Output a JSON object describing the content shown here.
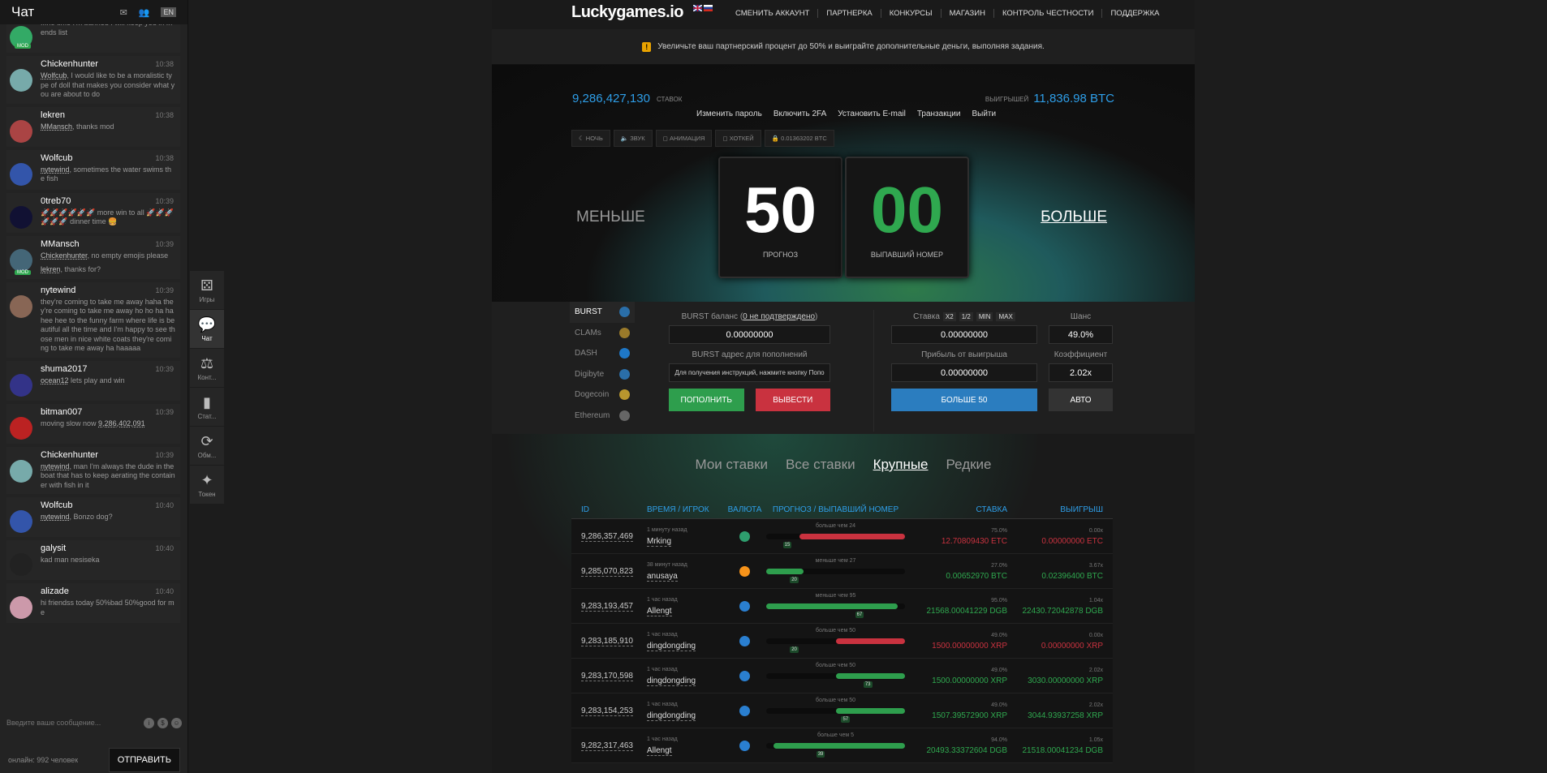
{
  "chat": {
    "title": "Чат",
    "lang": "EN",
    "messages": [
      {
        "name": "",
        "time": "",
        "text": "...no time I'm banned I will keep you in friends list",
        "mod": "MOD",
        "avatar_color": "#3a6"
      },
      {
        "name": "Chickenhunter",
        "time": "10:38",
        "ref": "Wolfcub",
        "text": ", I would like to be a moralistic type of doll that makes you consider what you are about to do",
        "avatar_color": "#7aa"
      },
      {
        "name": "lekren",
        "time": "10:38",
        "ref": "MMansch",
        "text": ", thanks mod",
        "avatar_color": "#a44"
      },
      {
        "name": "Wolfcub",
        "time": "10:38",
        "ref": "nytewind",
        "text": ", sometimes the water swims the fish",
        "avatar_color": "#35a"
      },
      {
        "name": "0treb70",
        "time": "10:39",
        "text": "🚀🚀🚀🚀🚀🚀 more win to all 🚀🚀🚀🚀🚀🚀 dinner time 🍔",
        "avatar_color": "#113"
      },
      {
        "name": "MMansch",
        "time": "10:39",
        "ref": "Chickenhunter",
        "text": ", no empty emojis please",
        "ref2": "lekren",
        "text2": ", thanks for?",
        "mod": "MOD",
        "avatar_color": "#467"
      },
      {
        "name": "nytewind",
        "time": "10:39",
        "text": "they're coming to take me away haha they're coming to take me away ho ho ha ha hee hee to the funny farm where life is beautiful all the time and I'm happy to see those men in nice white coats they're coming to take me away ha haaaaa",
        "avatar_color": "#865"
      },
      {
        "name": "shuma2017",
        "time": "10:39",
        "ref": "ocean12",
        "text": " lets play and win",
        "avatar_color": "#338"
      },
      {
        "name": "bitman007",
        "time": "10:39",
        "text": "moving slow now",
        "extra": "9,286,402,091",
        "avatar_color": "#b22"
      },
      {
        "name": "Chickenhunter",
        "time": "10:39",
        "ref": "nytewind",
        "text": ", man I'm always the dude in the boat that has to keep aerating the container with fish in it",
        "avatar_color": "#7aa"
      },
      {
        "name": "Wolfcub",
        "time": "10:40",
        "ref": "nytewind",
        "text": ", Bonzo dog?",
        "avatar_color": "#35a"
      },
      {
        "name": "galysit",
        "time": "10:40",
        "text": "kad man nesiseka",
        "avatar_color": "#222"
      },
      {
        "name": "alizade",
        "time": "10:40",
        "text": "hi friendss today 50%bad 50%good for me",
        "avatar_color": "#c9a"
      }
    ],
    "input_placeholder": "Введите ваше сообщение...",
    "online": "онлайн: 992 человек",
    "send_label": "ОТПРАВИТЬ"
  },
  "side_tabs": [
    {
      "icon": "dice-icon",
      "glyph": "⚄",
      "label": "Игры"
    },
    {
      "icon": "chat-icon",
      "glyph": "💬",
      "label": "Чат",
      "active": true
    },
    {
      "icon": "scales-icon",
      "glyph": "⚖",
      "label": "Конт..."
    },
    {
      "icon": "stats-icon",
      "glyph": "▮",
      "label": "Стат..."
    },
    {
      "icon": "exchange-icon",
      "glyph": "⟳",
      "label": "Обм..."
    },
    {
      "icon": "token-icon",
      "glyph": "✦",
      "label": "Токен"
    }
  ],
  "nav": {
    "logo": "Luckygames.io",
    "links": [
      "СМЕНИТЬ АККАУНТ",
      "ПАРТНЕРКА",
      "КОНКУРСЫ",
      "МАГАЗИН",
      "КОНТРОЛЬ ЧЕСТНОСТИ",
      "ПОДДЕРЖКА"
    ]
  },
  "banner": {
    "badge": "!",
    "text": "Увеличьте ваш партнерский процент до 50% и выиграйте дополнительные деньги, выполняя задания."
  },
  "hero": {
    "bets_value": "9,286,427,130",
    "bets_label": "СТАВОК",
    "wins_label": "ВЫИГРЫШЕЙ",
    "wins_value": "11,836.98 BTC",
    "account_links": [
      "Изменить пароль",
      "Включить 2FA",
      "Установить E-mail",
      "Транзакции",
      "Выйти"
    ],
    "toggles": [
      "☾ НОЧЬ",
      "🔈 ЗВУК",
      "◻ АНИМАЦИЯ",
      "◻ ХОТКЕЙ",
      "🔒 0.01363202 BTC"
    ],
    "less": "МЕНЬШЕ",
    "more": "БОЛЬШЕ",
    "forecast": "50",
    "forecast_label": "ПРОГНОЗ",
    "result": "00",
    "result_label": "ВЫПАВШИЙ НОМЕР"
  },
  "currencies": [
    {
      "name": "BURST",
      "color": "#2a6ea8",
      "active": true
    },
    {
      "name": "CLAMs",
      "color": "#9a7a2a"
    },
    {
      "name": "DASH",
      "color": "#1e78c8"
    },
    {
      "name": "Digibyte",
      "color": "#2a6ea8"
    },
    {
      "name": "Dogecoin",
      "color": "#b8962e"
    },
    {
      "name": "Ethereum",
      "color": "#666"
    }
  ],
  "wallet": {
    "balance_label": "BURST баланс (",
    "balance_unconfirmed": "0 не подтверждено",
    "balance_value": "0.00000000",
    "address_label": "BURST адрес для пополнений",
    "address_value": "Для получения инструкций, нажмите кнопку Попо",
    "deposit": "ПОПОЛНИТЬ",
    "withdraw": "ВЫВЕСТИ"
  },
  "bet": {
    "stake_label": "Ставка",
    "chips": [
      "X2",
      "1/2",
      "MIN",
      "MAX"
    ],
    "stake_value": "0.00000000",
    "profit_label": "Прибыль от выигрыша",
    "profit_value": "0.00000000",
    "bet_button": "БОЛЬШЕ 50",
    "chance_label": "Шанс",
    "chance_value": "49.0%",
    "coef_label": "Коэффициент",
    "coef_value": "2.02x",
    "auto_button": "АВТО"
  },
  "history": {
    "tabs": [
      "Мои ставки",
      "Все ставки",
      "Крупные",
      "Редкие"
    ],
    "active_tab": 2,
    "headers": [
      "ID",
      "ВРЕМЯ / ИГРОК",
      "ВАЛЮТА",
      "ПРОГНОЗ / ВЫПАВШИЙ НОМЕР",
      "СТАВКА",
      "ВЫИГРЫШ"
    ],
    "rows": [
      {
        "id": "9,286,357,469",
        "time": "1 минуту назад",
        "player": "Mrking",
        "coin": "#2e9e6e",
        "bar_label": "больше чем 24",
        "dir": "over",
        "target": 24,
        "result": 15,
        "win": false,
        "chance": "75.0%",
        "stake": "12.70809430 ETC",
        "mult": "0.00x",
        "payout": "0.00000000 ETC"
      },
      {
        "id": "9,285,070,823",
        "time": "38 минут назад",
        "player": "anusaya",
        "coin": "#f7931a",
        "bar_label": "меньше чем 27",
        "dir": "under",
        "target": 27,
        "result": 20,
        "win": true,
        "chance": "27.0%",
        "stake": "0.00652970 BTC",
        "mult": "3.67x",
        "payout": "0.02396400 BTC"
      },
      {
        "id": "9,283,193,457",
        "time": "1 час назад",
        "player": "Allengt",
        "coin": "#2a7fd0",
        "bar_label": "меньше чем 95",
        "dir": "under",
        "target": 95,
        "result": 67,
        "win": true,
        "chance": "95.0%",
        "stake": "21568.00041229 DGB",
        "mult": "1.04x",
        "payout": "22430.72042878 DGB"
      },
      {
        "id": "9,283,185,910",
        "time": "1 час назад",
        "player": "dingdongding",
        "coin": "#2a7fd0",
        "bar_label": "больше чем 50",
        "dir": "over",
        "target": 50,
        "result": 20,
        "win": false,
        "chance": "49.0%",
        "stake": "1500.00000000 XRP",
        "mult": "0.00x",
        "payout": "0.00000000 XRP"
      },
      {
        "id": "9,283,170,598",
        "time": "1 час назад",
        "player": "dingdongding",
        "coin": "#2a7fd0",
        "bar_label": "больше чем 50",
        "dir": "over",
        "target": 50,
        "result": 73,
        "win": true,
        "chance": "49.0%",
        "stake": "1500.00000000 XRP",
        "mult": "2.02x",
        "payout": "3030.00000000 XRP"
      },
      {
        "id": "9,283,154,253",
        "time": "1 час назад",
        "player": "dingdongding",
        "coin": "#2a7fd0",
        "bar_label": "больше чем 50",
        "dir": "over",
        "target": 50,
        "result": 57,
        "win": true,
        "chance": "49.0%",
        "stake": "1507.39572900 XRP",
        "mult": "2.02x",
        "payout": "3044.93937258 XRP"
      },
      {
        "id": "9,282,317,463",
        "time": "1 час назад",
        "player": "Allengt",
        "coin": "#2a7fd0",
        "bar_label": "больше чем 5",
        "dir": "over",
        "target": 5,
        "result": 39,
        "win": true,
        "chance": "94.0%",
        "stake": "20493.33372604 DGB",
        "mult": "1.05x",
        "payout": "21518.00041234 DGB"
      }
    ]
  }
}
